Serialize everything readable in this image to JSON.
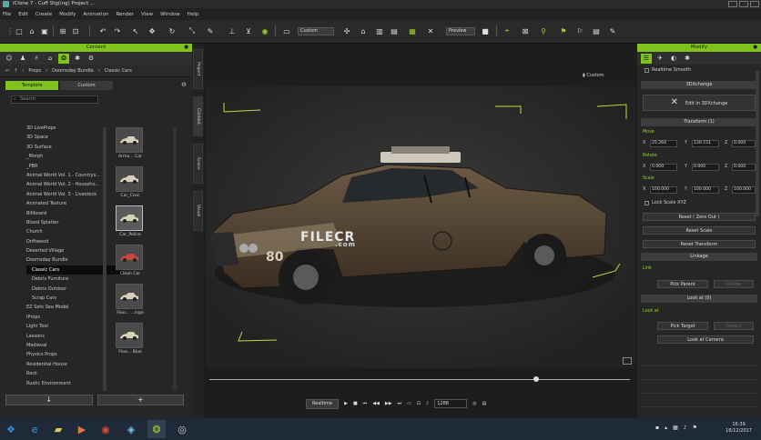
{
  "titlebar": {
    "title": "iClone 7 - Cuff Stg(ing) Project ..."
  },
  "menu": [
    "File",
    "Edit",
    "Create",
    "Modify",
    "Animation",
    "Render",
    "View",
    "Window",
    "Help"
  ],
  "toolbar": {
    "camera_dropdown": "Custom",
    "preview_dropdown": "Preview"
  },
  "content": {
    "title": "Content",
    "breadcrumb": [
      "Props",
      "Doomsday Bundle",
      "Classic Cars"
    ],
    "tabs": [
      "Template",
      "Custom"
    ],
    "search_placeholder": "Search",
    "tree": [
      "3D LiveProps",
      "3D Space",
      "3D Surface",
      "_Morph",
      "_PBR",
      "Animal World Vol. 1 - Countrys...",
      "Animal World Vol. 2 - Househo...",
      "Animal World Vol. 3 - Livestock",
      "Animated Texture",
      "Billboard",
      "Blood Splatter",
      "Church",
      "Driftwood",
      "Deserted Village",
      "Doomsday Bundle",
      "Classic Cars",
      "Debris Furniture",
      "Debris Outdoor",
      "Scrap Cars",
      "EZ Sets Sea Model",
      "iProps",
      "Light Tool",
      "Lessons",
      "Medieval",
      "Physics Props",
      "Residential House",
      "Rock",
      "Rustic Environment"
    ],
    "tree_selected": "Classic Cars",
    "thumbs": [
      "Armo... Car",
      "Car_Civic",
      "Car_Police",
      "Clean Car",
      "Floo... ...inge",
      "Floo... Blue"
    ],
    "thumb_selected": "Car_Police",
    "bottom_buttons": [
      "↓",
      "+"
    ]
  },
  "side_tabs": [
    "Project",
    "Content",
    "Scene",
    "Visual"
  ],
  "viewport": {
    "preset_label": "Custom",
    "watermark_main": "FILECR",
    "watermark_sub": ".com",
    "car_number": "80"
  },
  "playback": {
    "realtime": "Realtime",
    "frame": "1288"
  },
  "modify": {
    "title": "Modify",
    "realtime_smooth": "Realtime Smooth",
    "sec_3dxchange": "3DXchange",
    "edit_3dx": "Edit in 3DXchange",
    "sec_transform": "Transform (1)",
    "move_label": "Move",
    "move": {
      "x": "25.264",
      "y": "130.151",
      "z": "0.000"
    },
    "rotate_label": "Rotate",
    "rotate": {
      "x": "0.000",
      "y": "0.000",
      "z": "0.000"
    },
    "scale_label": "Scale",
    "scale": {
      "x": "100.000",
      "y": "100.000",
      "z": "100.000"
    },
    "lock_scale": "Lock Scale XYZ",
    "reset_zero": "Reset ( Zero Out )",
    "reset_scale": "Reset Scale",
    "reset_transform": "Reset Transform",
    "sec_linkage": "Linkage",
    "link_label": "Link",
    "pick_parent": "Pick Parent",
    "unlink": "Unlink",
    "sec_lookat": "Look at (0)",
    "lookat_label": "Look at",
    "pick_target": "Pick Target",
    "detach": "Detach",
    "lookat_camera": "Look at Camera"
  },
  "clock": {
    "time": "16:39",
    "date": "16/12/2017"
  }
}
